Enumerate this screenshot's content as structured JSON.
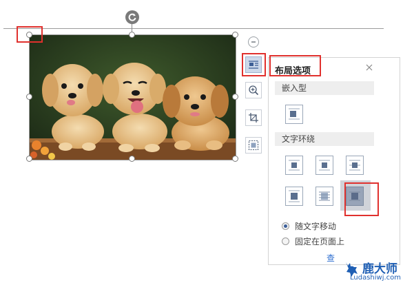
{
  "panel": {
    "title": "布局选项",
    "inline_section": "嵌入型",
    "wrap_section": "文字环绕",
    "radio_move": "随文字移动",
    "radio_fixed": "固定在页面上",
    "partial_link": "查"
  },
  "image": {
    "subject": "three golden retriever puppies on wooden fence"
  },
  "watermark": {
    "name": "鹿大师",
    "url": "Ludashiwj.com"
  },
  "colors": {
    "highlight_red": "#e0302d",
    "selected_option": "#a9b7cc",
    "active_tool": "#cdd9ea"
  },
  "icons": {
    "rotate": "rotate-icon",
    "collapse": "minus-icon",
    "layout": "layout-options-icon",
    "zoom": "zoom-in-icon",
    "crop": "crop-icon",
    "resize": "fit-frame-icon",
    "close": "close-icon"
  }
}
